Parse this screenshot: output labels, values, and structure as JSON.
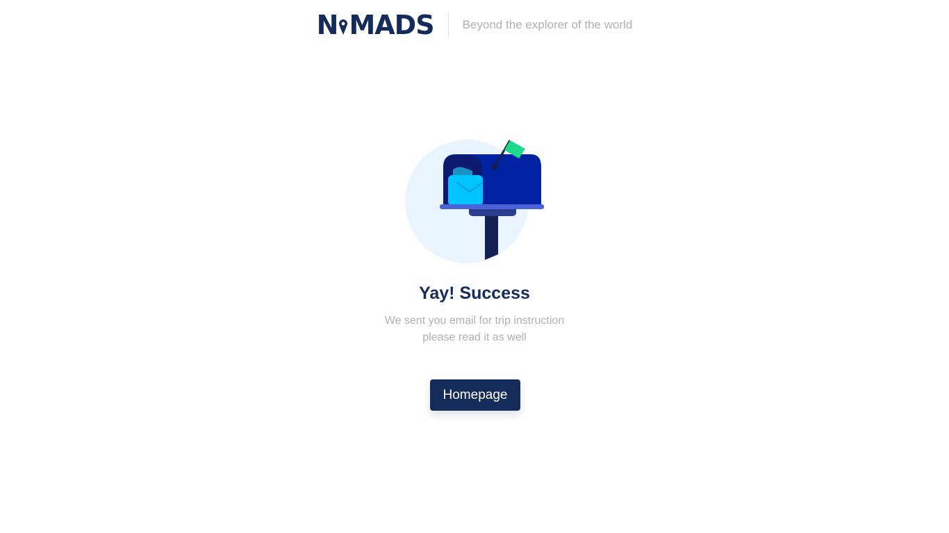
{
  "header": {
    "logo_text_left": "N",
    "logo_text_right": "MADS",
    "tagline": "Beyond the explorer of the world"
  },
  "illustration": {
    "icon": "mailbox-icon",
    "colors": {
      "circle": "#EAF4FE",
      "box": "#0022A3",
      "box_dark": "#0D1B6E",
      "envelope": "#00C4FF",
      "flag": "#1ED98C",
      "shelf": "#4A63D9",
      "post": "#152054"
    }
  },
  "message": {
    "title": "Yay! Success",
    "line1": "We sent you email for trip instruction",
    "line2": "please read it as well"
  },
  "actions": {
    "homepage_label": "Homepage"
  },
  "theme": {
    "primary": "#152C5B",
    "muted_text": "#B0B0B0"
  }
}
